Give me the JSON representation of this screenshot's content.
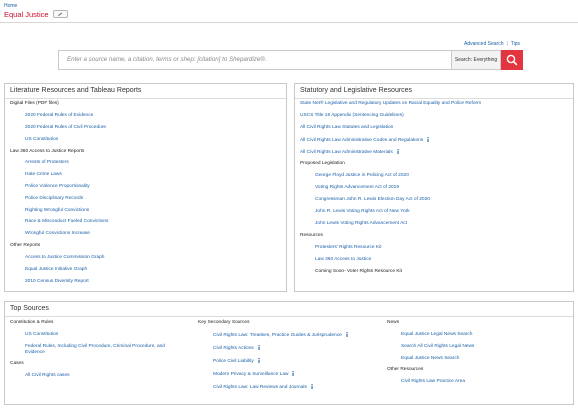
{
  "breadcrumb": "Home",
  "page_title": "Equal Justice",
  "edit_button_icon": "pencil-icon",
  "header_links": {
    "advanced_search": "Advanced Search",
    "tips": "Tips",
    "separator": "|"
  },
  "search": {
    "placeholder": "Enter a source name, a citation, terms or shep: [citation] to Shepardize®.",
    "scope": "Search: Everything",
    "button_icon": "search-icon"
  },
  "literature": {
    "title": "Literature Resources and Tableau Reports",
    "groups": [
      {
        "heading": "Digital Files (PDF files)",
        "items": [
          "2020 Federal Rules of Evidence",
          "2020 Federal Rules of Civil Procedure",
          "US Constitution"
        ]
      },
      {
        "heading": "Law 360 Access to Justice Reports",
        "items": [
          "Arrests of Protesters",
          "Hate Crime Laws",
          "Police Violence Proportionality",
          "Police Disciplinary Records",
          "Righting Wrongful Convictions",
          "Race & Misconduct Fueled Convictions",
          "Wrongful Convictions Increase"
        ]
      },
      {
        "heading": "Other Reports",
        "items": [
          "Access to Justice Commission Graph",
          "Equal Justice Initiative Graph",
          "2010 Census Diversity Report"
        ]
      }
    ]
  },
  "statutory": {
    "title": "Statutory and Legislative Resources",
    "top_items": [
      "State Net® Legislative and Regulatory Updates on Racial Equality and Police Reform",
      "USCS Title 18 Appendix (Sentencing Guidelines)",
      "All Civil Rights Law Statutes and Legislation",
      "All Civil Rights Law Administrative Codes and Regulations",
      "All Civil Rights Law Administrative Materials"
    ],
    "proposed_heading": "Proposed Legislation",
    "proposed_items": [
      "George Floyd Justice in Policing Act of 2020",
      "Voting Rights Advancement Act of 2019",
      "Congressman John R. Lewis Election Day Act of 2020",
      "John R. Lewis Voting Rights Act of New York",
      "John Lewis Voting Rights Advancement Act"
    ],
    "resources_heading": "Resources",
    "resources_items": [
      "Protesters' Rights Resource Kit",
      "Law 360 Access to Justice"
    ],
    "coming_soon": "Coming Soon- Voter Rights Resource Kit"
  },
  "top_sources": {
    "title": "Top Sources",
    "col1": {
      "heading": "Constitution & Rules",
      "items": [
        "US Constitution",
        "Federal Rules, Including Civil Procedure, Criminal Procedure, and",
        "Evidence"
      ],
      "cases_heading": "Cases",
      "cases_items": [
        "All Civil Rights cases"
      ]
    },
    "col2": {
      "heading": "Key Secondary Sources",
      "items": [
        "Civil Rights Law: Treatises, Practice Guides & Jurisprudence",
        "Civil Rights Actions",
        "Police Civil Liability",
        "Modern Privacy & Surveillance Law",
        "Civil Rights Law: Law Reviews and Journals"
      ]
    },
    "col3": {
      "heading": "News",
      "items": [
        "Equal Justice Legal News Search",
        "Search All Civil Rights Legal News",
        "Equal Justice News Search"
      ],
      "other_heading": "Other Resources",
      "other_items": [
        "Civil Rights Law Practice Area"
      ]
    }
  },
  "colors": {
    "link": "#1a5fa8",
    "title_red": "#c8102e",
    "search_button": "#e3353f",
    "info_icon": "#1a5fa8"
  },
  "info_icon": "info-icon"
}
